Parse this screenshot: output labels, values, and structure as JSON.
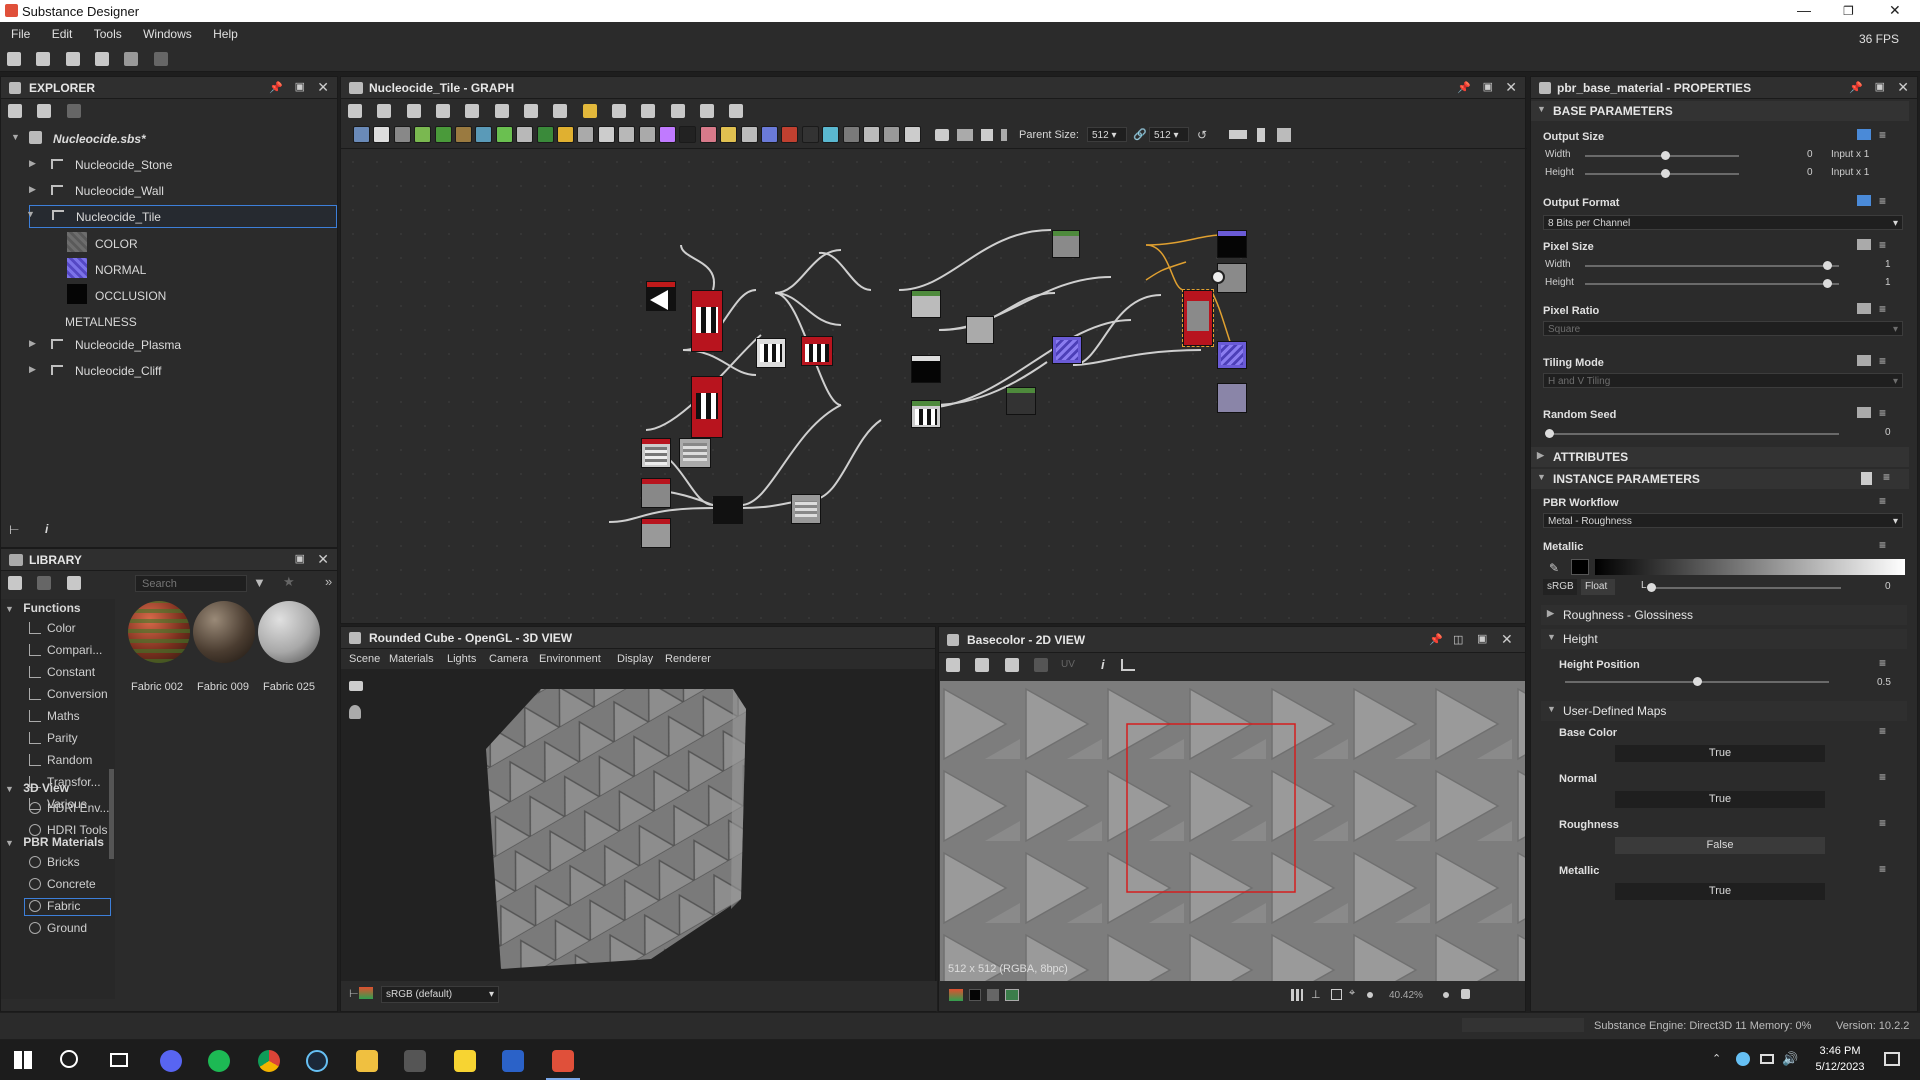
{
  "app": {
    "title": "Substance Designer",
    "fps": "36 FPS"
  },
  "menu": [
    "File",
    "Edit",
    "Tools",
    "Windows",
    "Help"
  ],
  "explorer": {
    "title": "EXPLORER",
    "package": "Nucleocide.sbs*",
    "graphs": [
      "Nucleocide_Stone",
      "Nucleocide_Wall",
      "Nucleocide_Tile"
    ],
    "outputs": [
      "COLOR",
      "NORMAL",
      "OCCLUSION",
      "METALNESS"
    ],
    "graphs2": [
      "Nucleocide_Plasma",
      "Nucleocide_Cliff"
    ]
  },
  "library": {
    "title": "LIBRARY",
    "search_placeholder": "Search",
    "categories": [
      {
        "name": "Functions",
        "items": [
          "Color",
          "Compari...",
          "Constant",
          "Conversion",
          "Maths",
          "Parity",
          "Random",
          "Transfor...",
          "Various"
        ]
      },
      {
        "name": "3D View",
        "items": [
          "HDRI Env...",
          "HDRI Tools"
        ]
      },
      {
        "name": "PBR Materials",
        "items": [
          "Bricks",
          "Concrete",
          "Fabric",
          "Ground"
        ]
      }
    ],
    "thumbnails": [
      "Fabric 002",
      "Fabric 009",
      "Fabric 025"
    ]
  },
  "graph": {
    "title": "Nucleocide_Tile - GRAPH",
    "parent_size_label": "Parent Size:",
    "size_a": "512",
    "size_b": "512"
  },
  "view3d": {
    "title": "Rounded Cube - OpenGL - 3D VIEW",
    "menu": [
      "Scene",
      "Materials",
      "Lights",
      "Camera",
      "Environment",
      "Display",
      "Renderer"
    ],
    "colorspace": "sRGB (default)"
  },
  "view2d": {
    "title": "Basecolor - 2D VIEW",
    "uv": "UV",
    "info": "512 x 512 (RGBA, 8bpc)",
    "zoom": "40.42%"
  },
  "properties": {
    "title": "pbr_base_material - PROPERTIES",
    "base_parameters": "BASE PARAMETERS",
    "output_size": "Output Size",
    "width": "Width",
    "height": "Height",
    "output_size_w_val": "0",
    "output_size_h_val": "0",
    "input_x1": "Input x 1",
    "output_format": "Output Format",
    "output_format_val": "8 Bits per Channel",
    "pixel_size": "Pixel Size",
    "pixel_size_w_val": "1",
    "pixel_size_h_val": "1",
    "pixel_ratio": "Pixel Ratio",
    "pixel_ratio_val": "Square",
    "tiling_mode": "Tiling Mode",
    "tiling_mode_val": "H and V Tiling",
    "random_seed": "Random Seed",
    "random_seed_val": "0",
    "attributes": "ATTRIBUTES",
    "instance_parameters": "INSTANCE PARAMETERS",
    "pbr_workflow": "PBR Workflow",
    "pbr_workflow_val": "Metal - Roughness",
    "metallic": "Metallic",
    "srgb": "sRGB",
    "float": "Float",
    "l": "L",
    "metallic_val": "0",
    "roughness_glossiness": "Roughness - Glossiness",
    "height_group": "Height",
    "height_position": "Height Position",
    "height_position_val": "0.5",
    "user_defined_maps": "User-Defined Maps",
    "maps": [
      {
        "label": "Base Color",
        "value": "True"
      },
      {
        "label": "Normal",
        "value": "True"
      },
      {
        "label": "Roughness",
        "value": "False"
      },
      {
        "label": "Metallic",
        "value": "True"
      }
    ]
  },
  "status": {
    "engine": "Substance Engine: Direct3D 11  Memory: 0%",
    "version": "Version: 10.2.2"
  },
  "taskbar": {
    "time": "3:46 PM",
    "date": "5/12/2023"
  },
  "colors": {
    "accent": "#3d7fd9",
    "panel": "#2b2b2b",
    "node_red": "#b8141e",
    "node_purple": "#6a5bd6",
    "selection_red": "#d41e1e"
  }
}
